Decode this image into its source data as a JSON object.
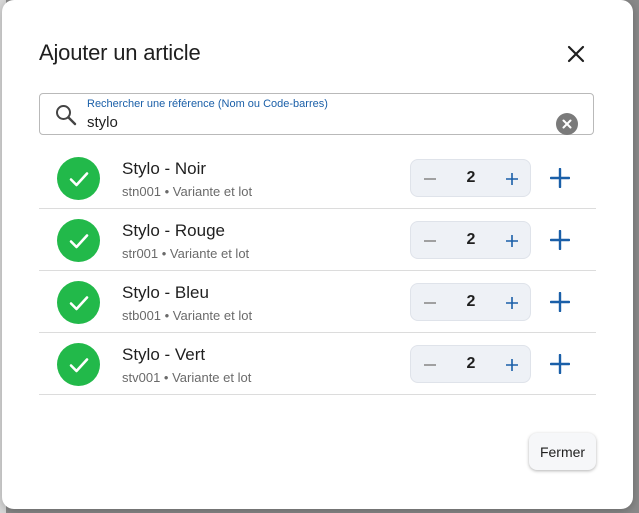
{
  "dialog": {
    "title": "Ajouter un article",
    "close_icon": "close-icon"
  },
  "search": {
    "label": "Rechercher une référence (Nom ou Code-barres)",
    "value": "stylo",
    "search_icon": "search-icon",
    "clear_icon": "clear-icon"
  },
  "items": [
    {
      "name": "Stylo - Noir",
      "meta": "stn001 • Variante et lot",
      "qty": "2",
      "status_icon": "check-icon"
    },
    {
      "name": "Stylo - Rouge",
      "meta": "str001 • Variante et lot",
      "qty": "2",
      "status_icon": "check-icon"
    },
    {
      "name": "Stylo - Bleu",
      "meta": "stb001 • Variante et lot",
      "qty": "2",
      "status_icon": "check-icon"
    },
    {
      "name": "Stylo - Vert",
      "meta": "stv001 • Variante et lot",
      "qty": "2",
      "status_icon": "check-icon"
    }
  ],
  "footer": {
    "close_label": "Fermer"
  },
  "colors": {
    "accent": "#1a5fa8",
    "success": "#22b94a"
  }
}
